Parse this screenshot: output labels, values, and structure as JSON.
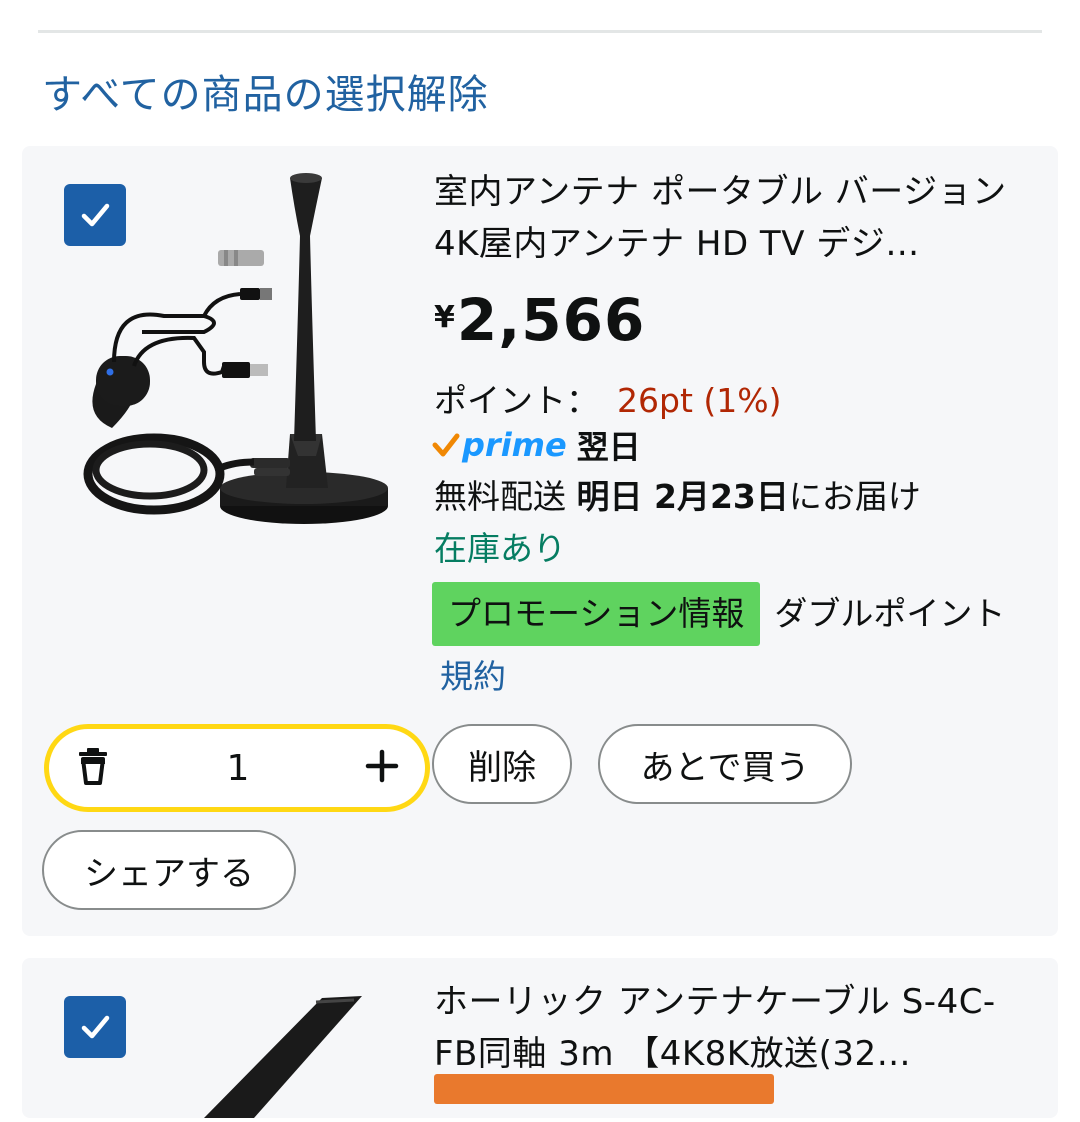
{
  "header": {
    "deselect_all_label": "すべての商品の選択解除"
  },
  "items": [
    {
      "checked": true,
      "title": "室内アンテナ ポータブル バージョン 4K屋内アンテナ HD TV デジ…",
      "price_symbol": "¥",
      "price": "2,566",
      "points_label": "ポイント：",
      "points_value": "26pt (1%)",
      "prime_label": "prime",
      "prime_day": "翌日",
      "delivery_prefix": "無料配送",
      "delivery_date": "明日 2月23日",
      "delivery_suffix": "にお届け",
      "stock": "在庫あり",
      "promo_badge": "プロモーション情報",
      "promo_text": "ダブルポイント",
      "terms_link": "規約",
      "quantity": "1",
      "delete_label": "削除",
      "save_later_label": "あとで買う",
      "share_label": "シェアする"
    },
    {
      "checked": true,
      "title": "ホーリック アンテナケーブル S-4C-FB同軸 3m 【4K8K放送(32…"
    }
  ],
  "colors": {
    "link": "#2162a1",
    "checkbox": "#1c5fa8",
    "points": "#b12704",
    "stock": "#067d62",
    "promo_badge": "#5fd35f",
    "stepper_border": "#ffd814",
    "prime_blue": "#1a98ff",
    "prime_check": "#f08804"
  },
  "icons": {
    "checkbox": "checkmark-icon",
    "trash": "trash-icon",
    "plus": "plus-icon",
    "prime_check": "prime-check-icon"
  }
}
